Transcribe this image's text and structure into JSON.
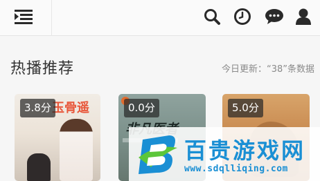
{
  "header": {
    "icons": [
      "menu-collapse-icon",
      "search-icon",
      "clock-icon",
      "chat-icon",
      "user-icon"
    ]
  },
  "section": {
    "title": "热播推荐",
    "update_note": "今日更新：“38”条数据"
  },
  "cards": [
    {
      "score": "3.8分",
      "poster_text": "玉骨遥"
    },
    {
      "score": "0.0分",
      "poster_text": "非凡医者"
    },
    {
      "score": "5.0分",
      "poster_text": ""
    }
  ],
  "watermark": {
    "title": "百贵游戏网",
    "url": "www.sdqlliqing.com"
  },
  "colors": {
    "topbar": "#fafafa",
    "icon": "#2a2a2a",
    "accent": "#1a8fd4",
    "score_bg": "#282828"
  }
}
